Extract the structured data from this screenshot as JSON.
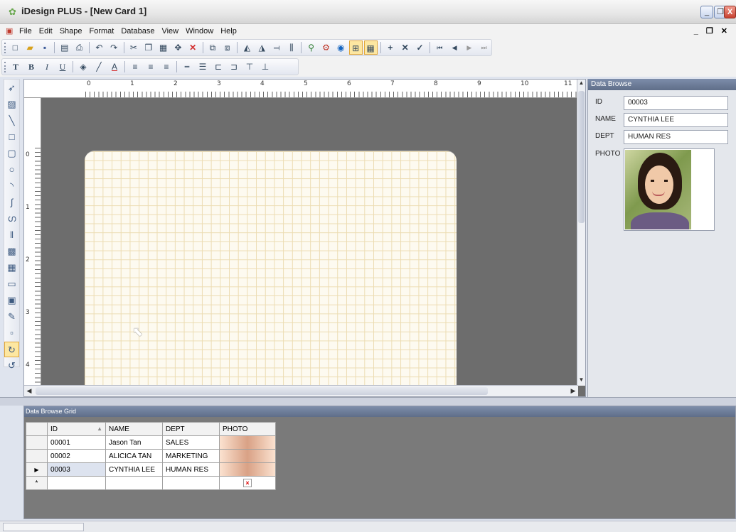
{
  "window": {
    "title": "iDesign PLUS - [New Card 1]",
    "controls": [
      "_",
      "❐",
      "X"
    ]
  },
  "menu": {
    "items": [
      "File",
      "Edit",
      "Shape",
      "Format",
      "Database",
      "View",
      "Window",
      "Help"
    ],
    "mdi_controls": "_ ❐ ✕"
  },
  "toolbar1": {
    "icons": [
      "new-icon",
      "open-icon",
      "save-icon",
      "print-preview-icon",
      "print-icon",
      "undo-icon",
      "redo-icon",
      "cut-icon",
      "copy-icon",
      "paste-icon",
      "select-all-icon",
      "delete-icon",
      "copy-format-icon",
      "paste-format-icon",
      "flip-horizontal-icon",
      "flip-vertical-icon",
      "align-icon",
      "barcode-icon",
      "link-database-icon",
      "search-icon",
      "record-icon",
      "snap-to-grid-icon",
      "grid-icon",
      "add-record-icon",
      "delete-record-icon",
      "post-record-icon",
      "first-record-icon",
      "prev-record-icon",
      "next-record-icon",
      "last-record-icon"
    ]
  },
  "toolbar2": {
    "icons": [
      "font-icon",
      "bold-icon",
      "italic-icon",
      "underline-icon",
      "fill-color-icon",
      "line-color-icon",
      "font-color-icon",
      "align-left-icon",
      "align-center-icon",
      "align-right-icon",
      "line-style-icon",
      "line-width-icon",
      "send-back-icon",
      "bring-front-icon",
      "align-top-icon",
      "align-bottom-icon"
    ]
  },
  "ruler": {
    "h_labels": [
      "0",
      "1",
      "2",
      "3",
      "4",
      "5",
      "6",
      "7",
      "8",
      "9",
      "10",
      "11"
    ],
    "v_labels": [
      "0",
      "1",
      "2",
      "3",
      "4"
    ]
  },
  "data_browse": {
    "title": "Data Browse",
    "fields": [
      {
        "label": "ID",
        "value": "00003"
      },
      {
        "label": "NAME",
        "value": "CYNTHIA LEE"
      },
      {
        "label": "DEPT",
        "value": "HUMAN RES"
      }
    ],
    "photo_label": "PHOTO"
  },
  "grid": {
    "title": "Data Browse Grid",
    "columns": [
      "ID",
      "NAME",
      "DEPT",
      "PHOTO"
    ],
    "rows": [
      {
        "id": "00001",
        "name": "Jason Tan",
        "dept": "SALES"
      },
      {
        "id": "00002",
        "name": "ALICICA TAN",
        "dept": "MARKETING"
      },
      {
        "id": "00003",
        "name": "CYNTHIA LEE",
        "dept": "HUMAN RES"
      }
    ],
    "current_row_marker": "▶",
    "new_row_marker": "*",
    "broken_image_glyph": "×"
  },
  "colors": {
    "card_grid_line": "#ecdcb2",
    "card_fill": "#fdfaf0",
    "workspace_bg": "#6d6d6d",
    "panel_title": "#5f6e89"
  }
}
